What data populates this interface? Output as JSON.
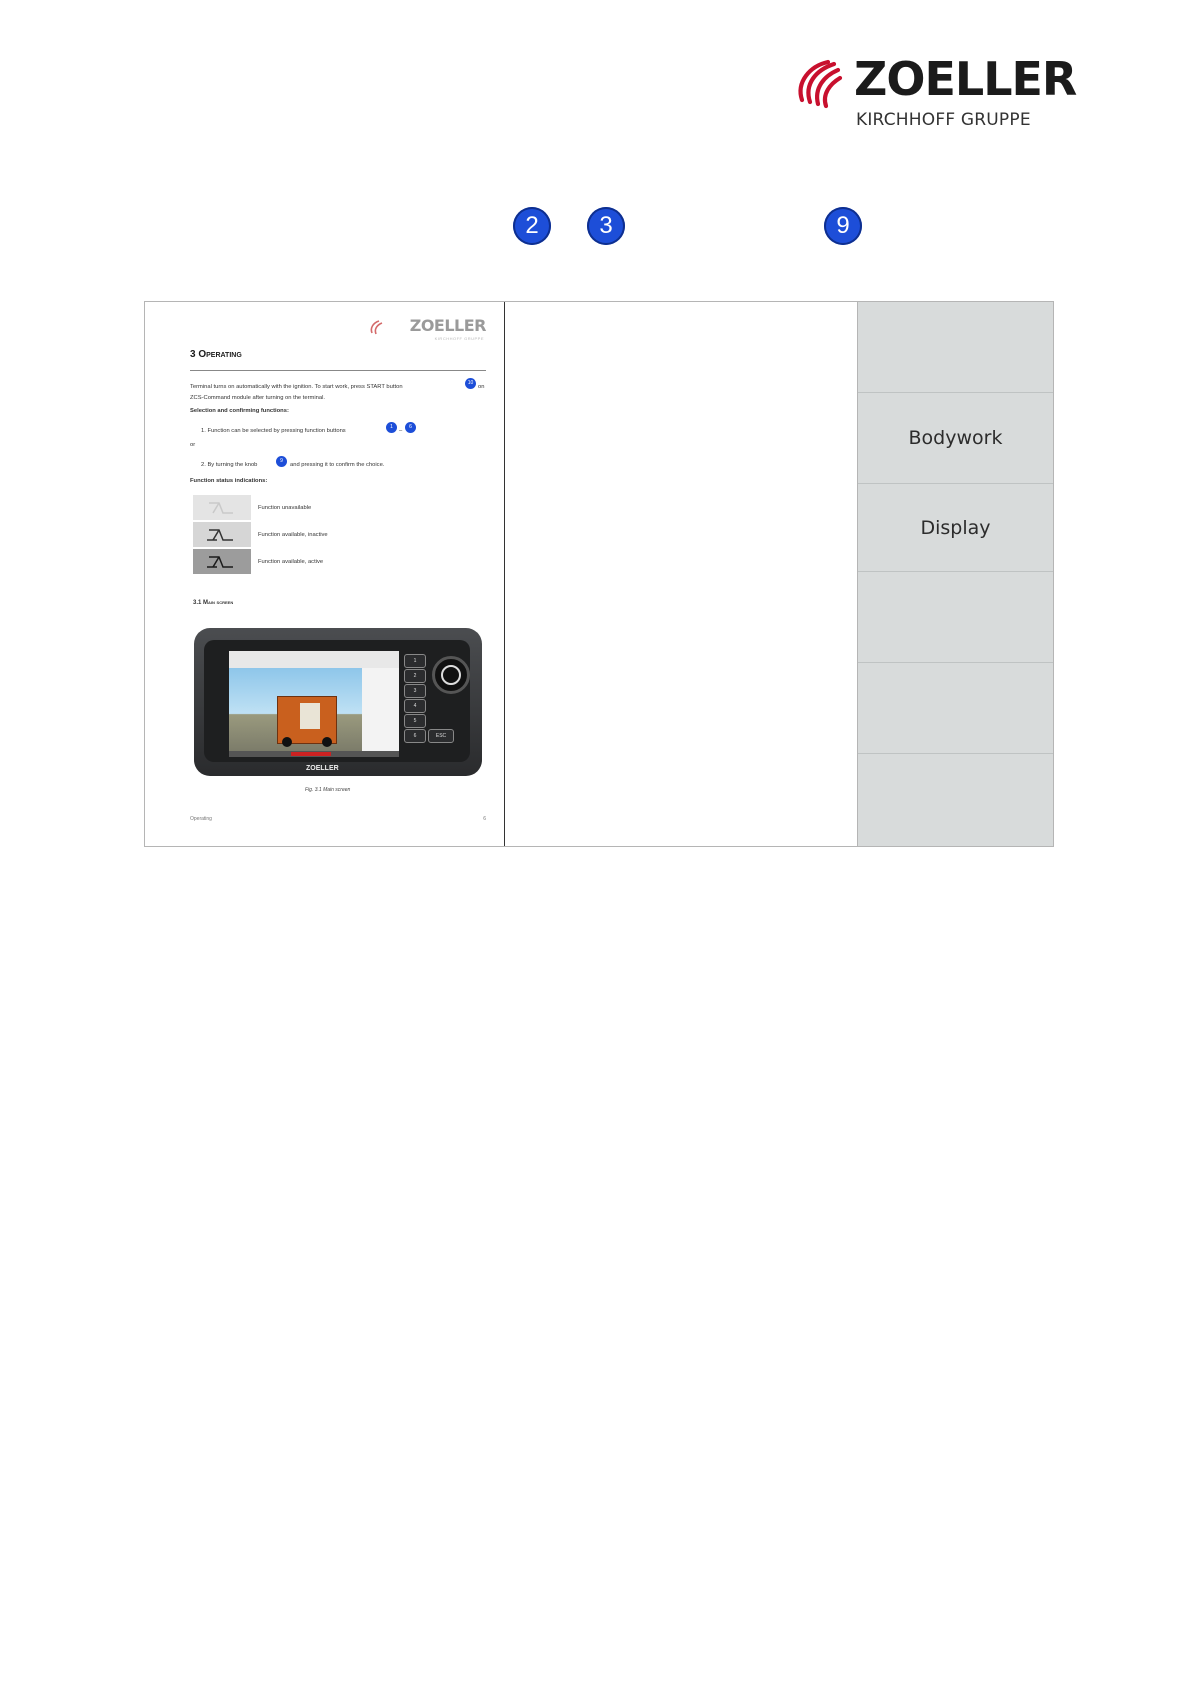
{
  "header": {
    "brand": "ZOELLER",
    "tagline": "KIRCHHOFF GRUPPE",
    "brand_color": "#c8102e"
  },
  "callouts": [
    "2",
    "3",
    "9"
  ],
  "preview": {
    "logo": "ZOELLER",
    "logo_sub": "KIRCHHOFF GRUPPE",
    "heading": "3  Operating",
    "intro_1": "Terminal turns on automatically with the ignition. To start work, press START button",
    "intro_badge": "10",
    "intro_1_tail": "on",
    "intro_2": "ZCS-Command module after turning on the terminal.",
    "selection_heading": "Selection and confirming functions:",
    "step_1": "1.   Function can be selected by pressing function buttons",
    "step_1_badge_a": "1",
    "step_1_dash": "–",
    "step_1_badge_b": "6",
    "or": "or",
    "step_2": "2.   By turning the knob",
    "step_2_badge": "9",
    "step_2_tail": "and pressing it to confirm the choice.",
    "status_heading": "Function status indications:",
    "legend": [
      {
        "label": "Function unavailable"
      },
      {
        "label": "Function available, inactive"
      },
      {
        "label": "Function available, active"
      }
    ],
    "subsection": "3.1     Main screen",
    "device_brand": "ZOELLER",
    "device_keys": [
      "1",
      "2",
      "3",
      "4",
      "5",
      "6"
    ],
    "device_esc": "ESC",
    "caption": "Fig. 3.1 Main screen",
    "footer_left": "Operating",
    "footer_right": "6"
  },
  "side_menu": [
    {
      "label": ""
    },
    {
      "label": "Bodywork"
    },
    {
      "label": "Display"
    },
    {
      "label": ""
    },
    {
      "label": ""
    },
    {
      "label": ""
    }
  ]
}
